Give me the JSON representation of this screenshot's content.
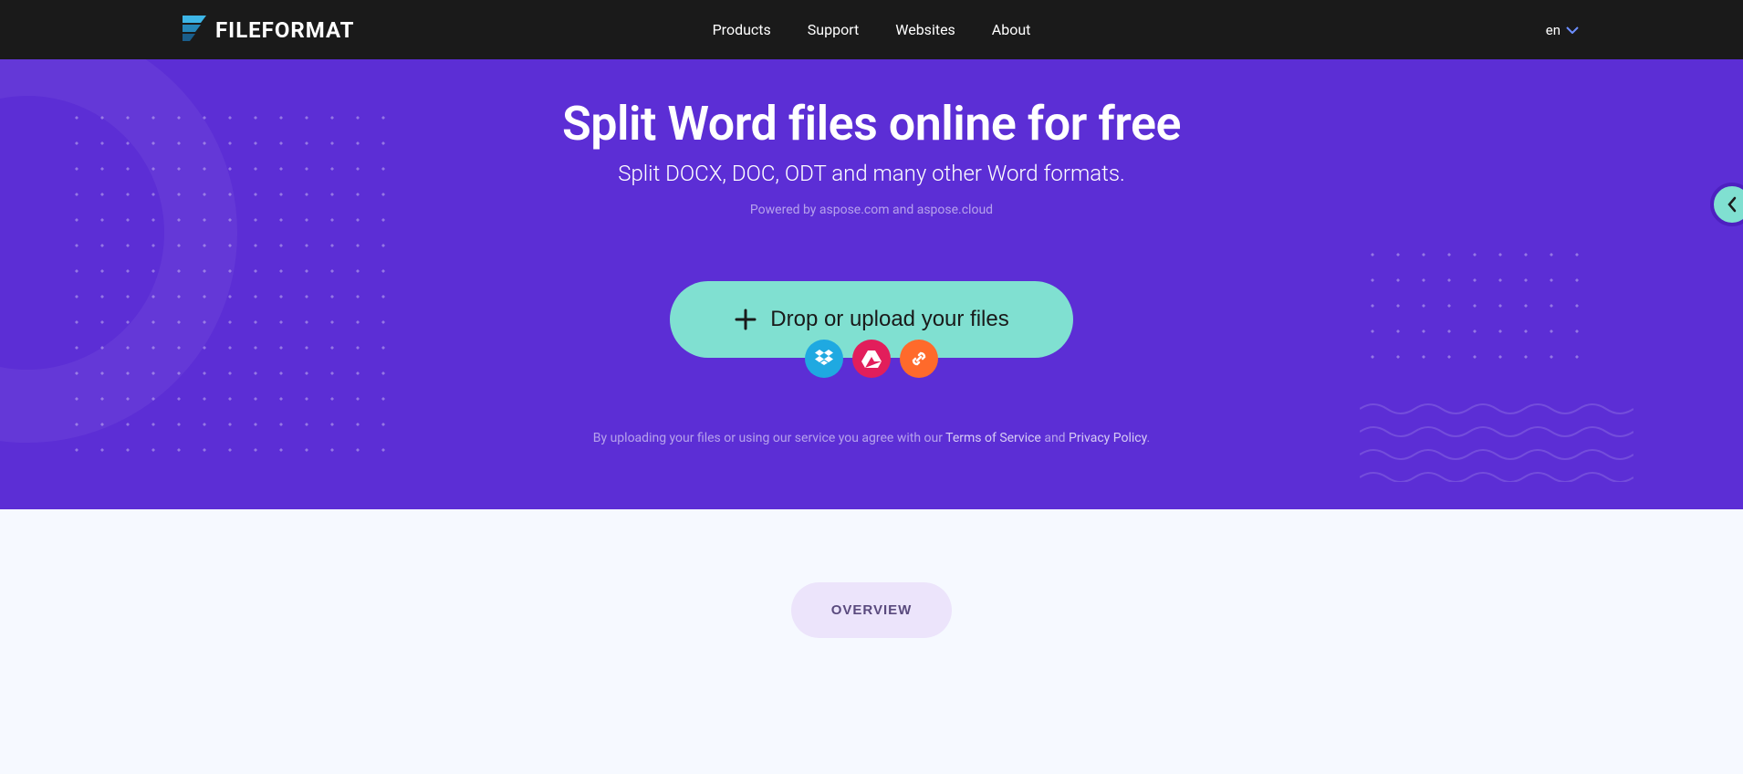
{
  "header": {
    "brand": "FILEFORMAT",
    "nav": {
      "products": "Products",
      "support": "Support",
      "websites": "Websites",
      "about": "About"
    },
    "language": "en"
  },
  "hero": {
    "title": "Split Word files online for free",
    "subtitle": "Split DOCX, DOC, ODT and many other Word formats.",
    "powered_prefix": "Powered by ",
    "powered_link1": "aspose.com",
    "powered_and": " and ",
    "powered_link2": "aspose.cloud",
    "upload_label": "Drop or upload your files",
    "agreement_prefix": "By uploading your files or using our service you agree with our ",
    "terms": "Terms of Service",
    "agreement_and": " and ",
    "privacy": "Privacy Policy",
    "agreement_suffix": "."
  },
  "sources": {
    "dropbox": "dropbox",
    "gdrive": "google-drive",
    "url": "url"
  },
  "lower": {
    "overview": "OVERVIEW"
  },
  "colors": {
    "hero_bg": "#5c2ed5",
    "accent": "#80e0d1",
    "gdrive": "#e21e5b",
    "dropbox": "#1fa9e1",
    "url": "#ff6a2b"
  }
}
